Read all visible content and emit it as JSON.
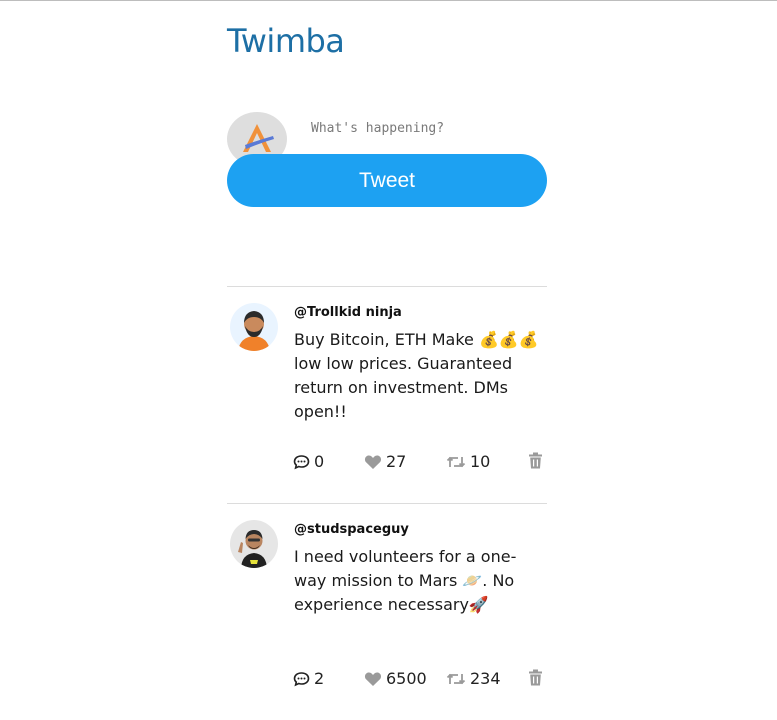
{
  "app": {
    "title": "Twimba"
  },
  "compose": {
    "placeholder": "What's happening?",
    "button_label": "Tweet"
  },
  "tweets": [
    {
      "handle": "@Trollkid ninja",
      "text": "Buy Bitcoin, ETH Make 💰💰💰 low low prices. Guaranteed return on investment. DMs open!!",
      "replies": "0",
      "likes": "27",
      "retweets": "10"
    },
    {
      "handle": "@studspaceguy",
      "text": "I need volunteers for a one-way mission to Mars 🪐. No experience necessary🚀",
      "replies": "2",
      "likes": "6500",
      "retweets": "234"
    }
  ],
  "colors": {
    "brand": "#1d6fa5",
    "button": "#1da1f2"
  },
  "icons": {
    "reply": "comment-dots-icon",
    "like": "heart-icon",
    "retweet": "retweet-icon",
    "delete": "trash-icon"
  }
}
